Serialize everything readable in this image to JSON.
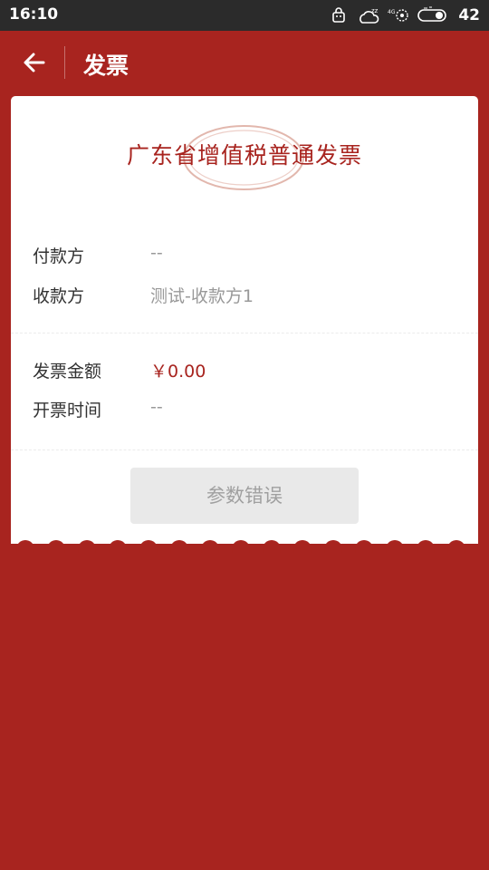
{
  "status_bar": {
    "time": "16:10",
    "battery": "42",
    "icons": [
      "notification-bag-icon",
      "weather-sleep-icon",
      "signal-4g-icon",
      "battery-icon"
    ]
  },
  "app_bar": {
    "title": "发票",
    "back_icon": "arrow-left-icon"
  },
  "invoice": {
    "title": "广东省增值税普通发票",
    "payer_label": "付款方",
    "payer_value": "--",
    "payee_label": "收款方",
    "payee_value": "测试-收款方1",
    "amount_label": "发票金额",
    "amount_value": "￥0.00",
    "issue_time_label": "开票时间",
    "issue_time_value": "--",
    "action_label": "参数错误"
  },
  "colors": {
    "brand_red": "#a8241f",
    "status_bar": "#2b2b2b",
    "card": "#ffffff",
    "disabled_button": "#e9e9e9"
  }
}
